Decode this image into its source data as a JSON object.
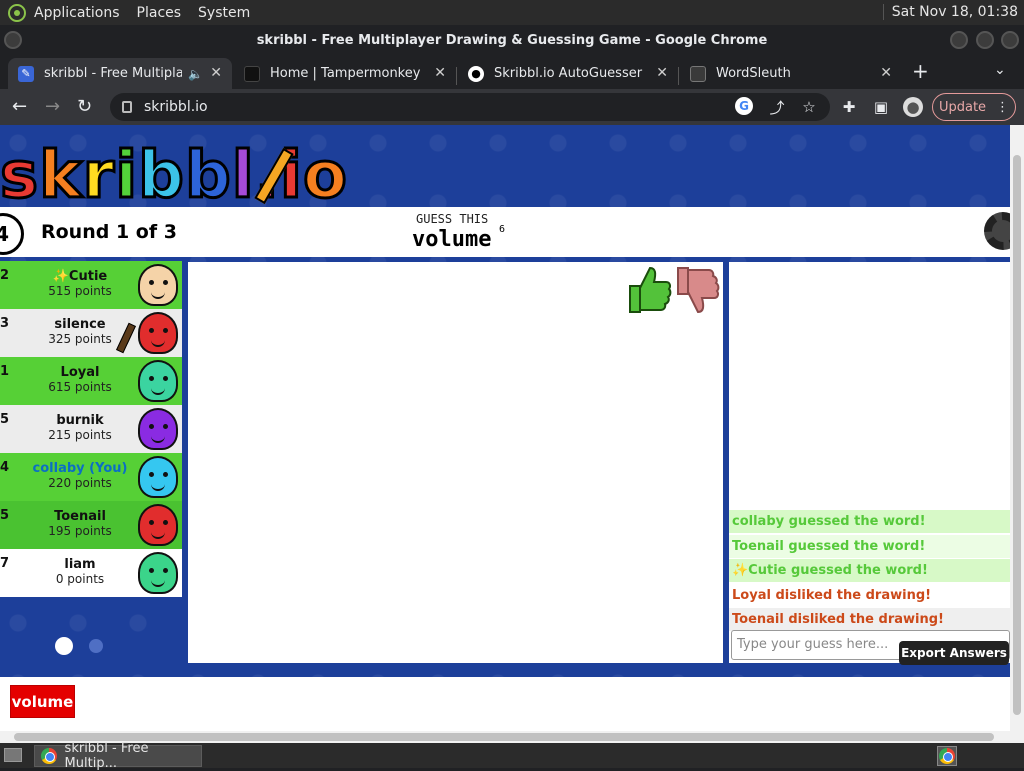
{
  "panel": {
    "menus": [
      "Applications",
      "Places",
      "System"
    ],
    "clock": "Sat Nov 18, 01:38"
  },
  "window": {
    "title": "skribbl - Free Multiplayer Drawing & Guessing Game - Google Chrome"
  },
  "tabs": [
    {
      "label": "skribbl - Free Multiplaye",
      "icon": "skribbl-pencil-icon"
    },
    {
      "label": "Home | Tampermonkey",
      "icon": "tampermonkey-icon"
    },
    {
      "label": "Skribbl.io AutoGuesser",
      "icon": "github-icon"
    },
    {
      "label": "WordSleuth",
      "icon": "wordsleuth-icon"
    }
  ],
  "toolbar": {
    "url": "skribbl.io",
    "update_label": "Update"
  },
  "game": {
    "logo_letters": [
      "s",
      "k",
      "r",
      "i",
      "b",
      "b",
      "l",
      ".",
      "i",
      "o"
    ],
    "logo_colors": [
      "#e83a33",
      "#f57f20",
      "#ffdb21",
      "#53d23a",
      "#3cc3e8",
      "#2d64d8",
      "#a74bd8",
      "#ff4fa8",
      "#e83a33",
      "#f57f20"
    ],
    "timer": "4",
    "round": "Round 1 of 3",
    "guess_label": "GUESS THIS",
    "word": "volume",
    "word_length": "6",
    "players": [
      {
        "rank": "2",
        "name": "✨Cutie",
        "points": "515 points",
        "bg": "#56d036",
        "avatar": "#f5d3a8"
      },
      {
        "rank": "3",
        "name": "silence",
        "points": "325 points",
        "bg": "#ececec",
        "avatar": "#e12d2d"
      },
      {
        "rank": "1",
        "name": "Loyal",
        "points": "615 points",
        "bg": "#56d036",
        "avatar": "#3bd4a0"
      },
      {
        "rank": "5",
        "name": "burnik",
        "points": "215 points",
        "bg": "#ececec",
        "avatar": "#8a2be2"
      },
      {
        "rank": "4",
        "name": "collaby (You)",
        "points": "220 points",
        "bg": "#56d036",
        "avatar": "#35c7f0",
        "self": true
      },
      {
        "rank": "5",
        "name": "Toenail",
        "points": "195 points",
        "bg": "#4ac231",
        "avatar": "#e12d2d"
      },
      {
        "rank": "7",
        "name": "liam",
        "points": "0 points",
        "bg": "#ffffff",
        "avatar": "#3bd48a"
      }
    ],
    "chat": [
      {
        "text": "collaby guessed the word!",
        "color": "#56c93a",
        "bg": "#d7f9c7"
      },
      {
        "text": "Toenail guessed the word!",
        "color": "#56c93a",
        "bg": "#ecfde4"
      },
      {
        "text": "✨Cutie guessed the word!",
        "color": "#56c93a",
        "bg": "#d7f9c7"
      },
      {
        "text": "Loyal disliked the drawing!",
        "color": "#cc4a1a",
        "bg": "#ffffff"
      },
      {
        "text": "Toenail disliked the drawing!",
        "color": "#cc4a1a",
        "bg": "#efefef"
      }
    ],
    "guess_placeholder": "Type your guess here...",
    "export_label": "Export Answers",
    "word_badge": "volume"
  },
  "taskbar": {
    "item": "skribbl - Free Multip..."
  }
}
